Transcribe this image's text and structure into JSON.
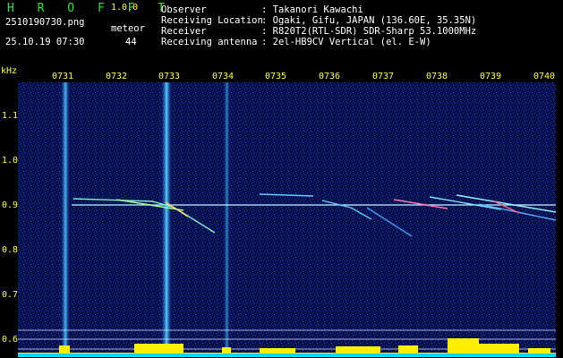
{
  "header": {
    "logo": "H R O F F T",
    "version": "1.0.0",
    "filename": "2510190730.png",
    "datetime": "25.10.19 07:30",
    "meteor_label": "meteor",
    "meteor_count": "44",
    "info_labels": [
      "Observer",
      "Receiving Location",
      "Receiver",
      "Receiving antenna"
    ],
    "info_values": [
      ": Takanori Kawachi",
      ": Ogaki, Gifu, JAPAN (136.60E, 35.35N)",
      ": R820T2(RTL-SDR) SDR-Sharp 53.1000MHz",
      ": 2el-HB9CV Vertical (el. E-W)"
    ]
  },
  "axis": {
    "unit": "kHz",
    "y_ticks": [
      "1.1",
      "1.0",
      "0.9",
      "0.8",
      "0.7",
      "0.6"
    ],
    "time_ticks": [
      "0731",
      "0732",
      "0733",
      "0734",
      "0735",
      "0736",
      "0737",
      "0738",
      "0739",
      "0740"
    ]
  },
  "colors": {
    "background": "#000000",
    "plot_bg": "#06104a",
    "noise": "#1e3cc8",
    "label": "#ffff33",
    "logo": "#2fe62f",
    "carrier": "#b9f0ff",
    "meteor_streak": "#4ad6ff",
    "power_bar": "#ffee00",
    "baseline": "#00d8ff"
  }
}
